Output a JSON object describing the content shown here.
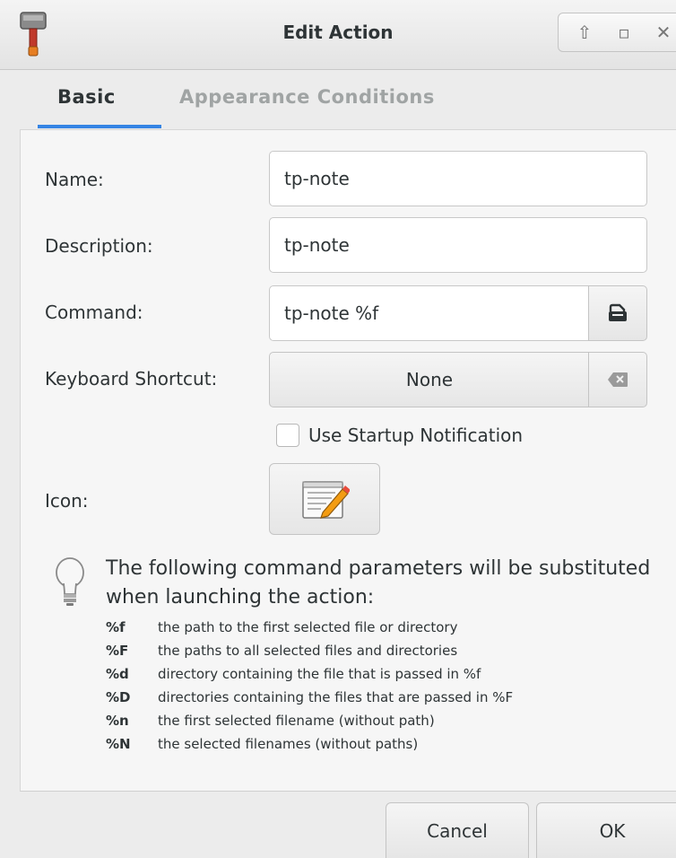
{
  "window": {
    "title": "Edit Action",
    "controls": [
      "up",
      "maximize",
      "close"
    ]
  },
  "tabs": [
    {
      "label": "Basic",
      "active": true
    },
    {
      "label": "Appearance Conditions",
      "active": false
    }
  ],
  "form": {
    "name": {
      "label": "Name:",
      "value": "tp-note"
    },
    "description": {
      "label": "Description:",
      "value": "tp-note"
    },
    "command": {
      "label": "Command:",
      "value": "tp-note %f",
      "browse_icon": "file-browse-icon"
    },
    "shortcut": {
      "label": "Keyboard Shortcut:",
      "value": "None",
      "clear_icon": "backspace-icon"
    },
    "startup_notification": {
      "label": "Use Startup Notification",
      "checked": false
    },
    "icon": {
      "label": "Icon:",
      "icon_name": "text-editor-icon"
    }
  },
  "hint": {
    "icon": "lightbulb-icon",
    "text": "The following command parameters will be substituted when launching the action:",
    "params": [
      {
        "key": "%f",
        "desc": "the path to the first selected file or directory"
      },
      {
        "key": "%F",
        "desc": "the paths to all selected files and directories"
      },
      {
        "key": "%d",
        "desc": "directory containing the file that is passed in %f"
      },
      {
        "key": "%D",
        "desc": "directories containing the files that are passed in %F"
      },
      {
        "key": "%n",
        "desc": "the first selected filename (without path)"
      },
      {
        "key": "%N",
        "desc": "the selected filenames (without paths)"
      }
    ]
  },
  "footer": {
    "cancel_label": "Cancel",
    "ok_label": "OK"
  },
  "colors": {
    "accent": "#3584e4",
    "background": "#ececec",
    "inactive_tab": "#a0a4a4"
  }
}
